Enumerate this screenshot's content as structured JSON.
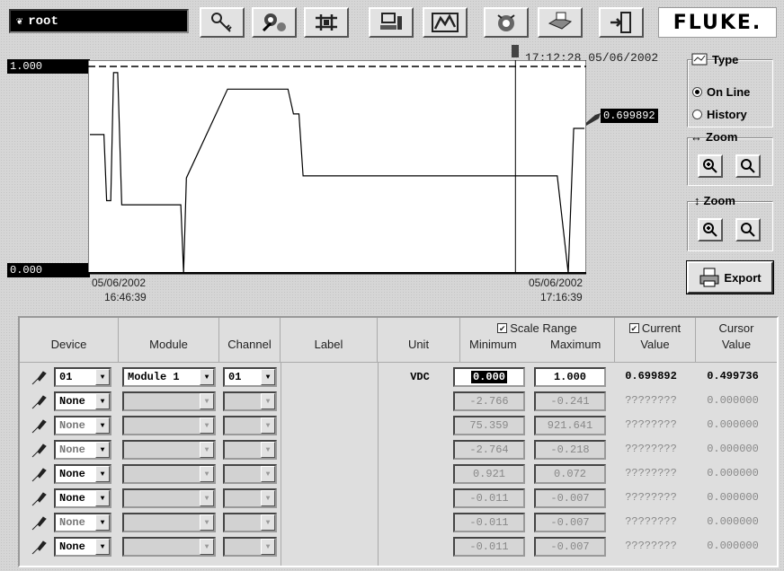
{
  "user": "root",
  "brand": "FLUKE.",
  "toolbar": {
    "buttons": [
      "keys-icon",
      "tools-icon",
      "network-icon",
      "computer-icon",
      "trend-chart-icon",
      "alarm-icon",
      "hand-printer-icon",
      "exit-door-icon"
    ]
  },
  "chart": {
    "y_max_label": "1.000",
    "y_min_label": "0.000",
    "cursor_time": "17:12:28 05/06/2002",
    "current_value": "0.699892",
    "start_date": "05/06/2002",
    "start_time": "16:46:39",
    "end_date": "05/06/2002",
    "end_time": "17:16:39"
  },
  "chart_data": {
    "type": "line",
    "xlim": [
      "05/06/2002 16:46:39",
      "05/06/2002 17:16:39"
    ],
    "ylim": [
      0.0,
      1.0
    ],
    "cursor_x": "17:12:28",
    "cursor_value": 0.499736,
    "current_value": 0.699892,
    "series": [
      {
        "points": [
          [
            "16:46:39",
            0.67
          ],
          [
            "16:47:30",
            0.67
          ],
          [
            "16:47:40",
            0.35
          ],
          [
            "16:47:55",
            0.35
          ],
          [
            "16:48:05",
            0.97
          ],
          [
            "16:48:20",
            0.97
          ],
          [
            "16:48:35",
            0.33
          ],
          [
            "16:52:10",
            0.33
          ],
          [
            "16:52:20",
            0.0
          ],
          [
            "16:52:30",
            0.46
          ],
          [
            "16:55:00",
            0.89
          ],
          [
            "16:58:40",
            0.89
          ],
          [
            "16:59:00",
            0.77
          ],
          [
            "16:59:20",
            0.77
          ],
          [
            "16:59:35",
            0.47
          ],
          [
            "17:15:00",
            0.47
          ],
          [
            "17:15:40",
            0.0
          ],
          [
            "17:16:00",
            0.7
          ],
          [
            "17:16:39",
            0.7
          ]
        ]
      }
    ],
    "reference_lines": [
      1.0
    ]
  },
  "side_panel": {
    "type_title": "Type",
    "online_label": "On Line",
    "history_label": "History",
    "selected_type": "On Line",
    "hzoom_title": "Zoom",
    "vzoom_title": "Zoom",
    "export_label": "Export"
  },
  "table": {
    "headers": {
      "device": "Device",
      "module": "Module",
      "channel": "Channel",
      "label": "Label",
      "unit": "Unit",
      "scale_range": "Scale Range",
      "minimum": "Minimum",
      "maximum": "Maximum",
      "current": "Current",
      "current2": "Value",
      "cursor": "Cursor",
      "cursor2": "Value"
    },
    "rows": [
      {
        "device": "01",
        "module": "Module 1",
        "channel": "01",
        "label": "",
        "unit": "VDC",
        "min": "0.000",
        "max": "1.000",
        "current": "0.699892",
        "cursor": "0.499736",
        "active": true,
        "device_gray": false
      },
      {
        "device": "None",
        "module": "",
        "channel": "",
        "label": "",
        "unit": "",
        "min": "-2.766",
        "max": "-0.241",
        "current": "????????",
        "cursor": "0.000000",
        "active": false,
        "device_gray": false
      },
      {
        "device": "None",
        "module": "",
        "channel": "",
        "label": "",
        "unit": "",
        "min": "75.359",
        "max": "921.641",
        "current": "????????",
        "cursor": "0.000000",
        "active": false,
        "device_gray": true
      },
      {
        "device": "None",
        "module": "",
        "channel": "",
        "label": "",
        "unit": "",
        "min": "-2.764",
        "max": "-0.218",
        "current": "????????",
        "cursor": "0.000000",
        "active": false,
        "device_gray": true
      },
      {
        "device": "None",
        "module": "",
        "channel": "",
        "label": "",
        "unit": "",
        "min": "0.921",
        "max": "0.072",
        "current": "????????",
        "cursor": "0.000000",
        "active": false,
        "device_gray": false
      },
      {
        "device": "None",
        "module": "",
        "channel": "",
        "label": "",
        "unit": "",
        "min": "-0.011",
        "max": "-0.007",
        "current": "????????",
        "cursor": "0.000000",
        "active": false,
        "device_gray": false
      },
      {
        "device": "None",
        "module": "",
        "channel": "",
        "label": "",
        "unit": "",
        "min": "-0.011",
        "max": "-0.007",
        "current": "????????",
        "cursor": "0.000000",
        "active": false,
        "device_gray": true
      },
      {
        "device": "None",
        "module": "",
        "channel": "",
        "label": "",
        "unit": "",
        "min": "-0.011",
        "max": "-0.007",
        "current": "????????",
        "cursor": "0.000000",
        "active": false,
        "device_gray": false
      }
    ]
  }
}
